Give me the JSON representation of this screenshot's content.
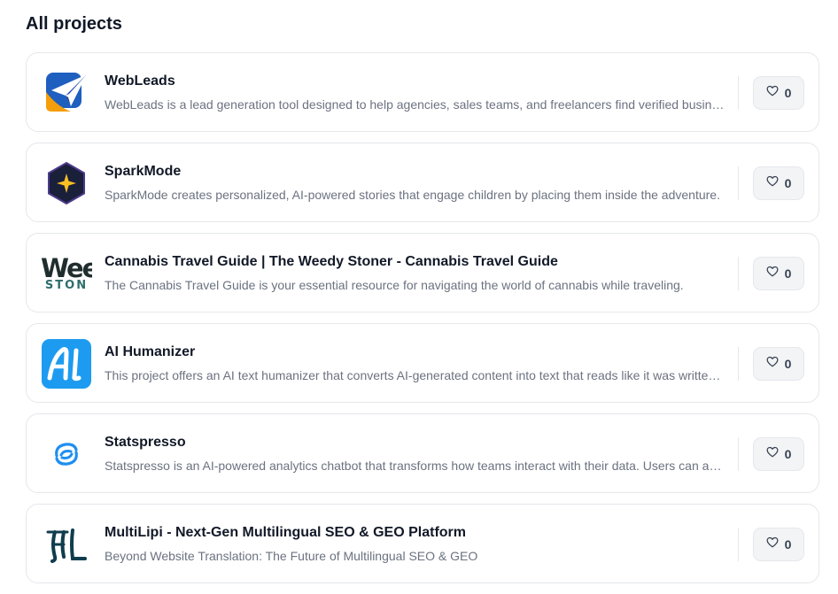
{
  "page": {
    "heading": "All projects"
  },
  "projects": [
    {
      "name": "WebLeads",
      "description": "WebLeads is a lead generation tool designed to help agencies, sales teams, and freelancers find verified business leads and generate targeted contact lists.",
      "likes": "0",
      "logo_icon": "paper-plane-logo-icon"
    },
    {
      "name": "SparkMode",
      "description": "SparkMode creates personalized, AI-powered stories that engage children by placing them inside the adventure.",
      "likes": "0",
      "logo_icon": "hexagon-spark-logo-icon"
    },
    {
      "name": "Cannabis Travel Guide | The Weedy Stoner - Cannabis Travel Guide",
      "description": "The Cannabis Travel Guide is your essential resource for navigating the world of cannabis while traveling.",
      "likes": "0",
      "logo_icon": "weedy-stoner-logo",
      "logo_text_top": "Wee",
      "logo_text_bottom": "STON"
    },
    {
      "name": "AI Humanizer",
      "description": "This project offers an AI text humanizer that converts AI-generated content into text that reads like it was written by a human.",
      "likes": "0",
      "logo_icon": "ai-letters-logo-icon"
    },
    {
      "name": "Statspresso",
      "description": "Statspresso is an AI-powered analytics chatbot that transforms how teams interact with their data. Users can ask questions in plain English.",
      "likes": "0",
      "logo_icon": "swirl-logo-icon"
    },
    {
      "name": "MultiLipi - Next-Gen Multilingual SEO & GEO Platform",
      "description": "Beyond Website Translation: The Future of Multilingual SEO & GEO",
      "likes": "0",
      "logo_icon": "hl-letters-logo-icon"
    }
  ],
  "colors": {
    "text_primary": "#111827",
    "text_secondary": "#6b7280",
    "border": "#e5e7eb",
    "like_bg": "#f3f4f6"
  }
}
